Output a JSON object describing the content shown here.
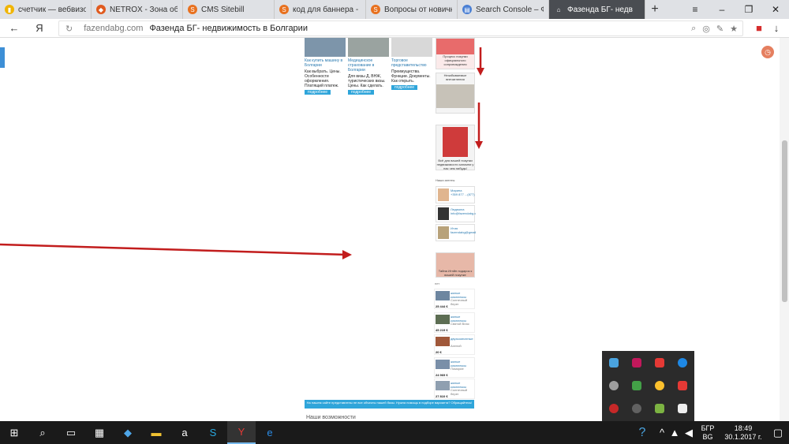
{
  "browser": {
    "tabs": [
      {
        "title": "счетчик — вебвизор",
        "color": "#f0b400",
        "glyph": "▮"
      },
      {
        "title": "NETROX - Зона общ",
        "color": "#e05a1e",
        "glyph": "◆"
      },
      {
        "title": "CMS Sitebill",
        "color": "#e8711f",
        "glyph": "S"
      },
      {
        "title": "код для баннера - П",
        "color": "#e8711f",
        "glyph": "S"
      },
      {
        "title": "Вопросы от новичк",
        "color": "#e8711f",
        "glyph": "S"
      },
      {
        "title": "Search Console – Фа",
        "color": "#4a7fd4",
        "glyph": "▤"
      },
      {
        "title": "Фазенда БГ- недв",
        "color": "#4a4d52",
        "glyph": "⌂"
      }
    ],
    "address": {
      "domain": "fazendabg.com",
      "title": "Фазенда БГ- недвижимость в Болгарии"
    }
  },
  "page": {
    "cards": [
      {
        "link": "Как купить машину в Болгарии",
        "desc": "Как выбрать. Цены. Особенности оформления. Платящий платеж.",
        "btn": "подробнее"
      },
      {
        "link": "Медицинское страхование в Болгарии",
        "desc": "Для визы Д, ВНЖ, туристических визы. Цены. Как сделать.",
        "btn": "подробнее"
      },
      {
        "link": "Торговое представительство",
        "desc": "Преимущества. Функции. Документы. Как открыть.",
        "btn": "подробнее"
      }
    ],
    "side_captions": [
      "Процесс покупки официального сопровождения",
      "Незабываемые впечатления",
      "Всё для вашей покупки недвижимости запомни у нас чем нибудь!"
    ],
    "agents_title": "Наши агенты",
    "agents": [
      {
        "name": "Марина",
        "line": "+359 877 ...(877)"
      },
      {
        "name": "Людмила",
        "line": "info@fazendabg.com"
      },
      {
        "name": "Ития",
        "line": "fazendabg@gmail.com"
      }
    ],
    "sell_caption": "Тайна Итэйн подарок к вашей покупке",
    "section_label": "нет",
    "listings": [
      {
        "name": "жилые комплексы",
        "loc": "Солнечный берег",
        "price": "25 444 €"
      },
      {
        "name": "жилые комплексы",
        "loc": "Святой Влас",
        "price": "45 219 €"
      },
      {
        "name": "двухкомнатные",
        "loc": "Ахелой",
        "price": "20 €"
      },
      {
        "name": "жилые комплексы",
        "loc": "Поморие",
        "price": "24 969 €"
      },
      {
        "name": "жилые комплексы",
        "loc": "Солнечный берег",
        "price": "27 810 €"
      }
    ],
    "blue_bar": "На нашем сайте представлены не все объекты нашей базы. Нужна помощь в подборе варианта? Обращайтесь!",
    "below_text": "Наши возможности"
  },
  "taskbar": {
    "apps": [
      "start",
      "search",
      "taskview",
      "store",
      "dropbox",
      "explorer",
      "amazon",
      "skype",
      "yandex",
      "edge"
    ],
    "lang_top": "БГР",
    "lang_bottom": "BG",
    "time": "18:49",
    "date": "30.1.2017 г."
  },
  "tray_colors": [
    "#4aa3df",
    "#c2185b",
    "#e53935",
    "#1e88e5",
    "#9e9e9e",
    "#43a047",
    "#fbc02d",
    "#e53935",
    "#c62828",
    "#616161",
    "#7cb342",
    "#eeeeee"
  ]
}
